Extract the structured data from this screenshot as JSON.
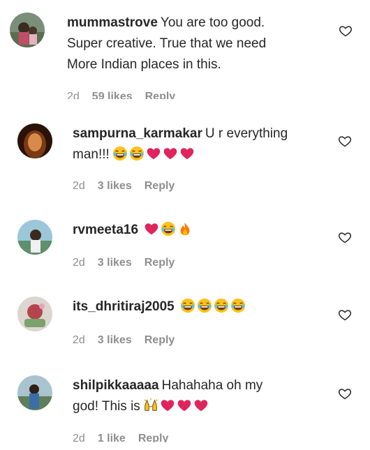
{
  "comments": [
    {
      "username": "mummastrove",
      "text_lines": [
        "You are too good.",
        "Super creative. True that we need",
        "More Indian places in this."
      ],
      "time": "2d",
      "likes": "59 likes",
      "reply": "Reply",
      "emojis": []
    },
    {
      "username": "sampurna_karmakar",
      "text_lines": [
        "U r everything",
        "man!!!"
      ],
      "time": "2d",
      "likes": "3 likes",
      "reply": "Reply",
      "emojis": [
        "laughing-emoji",
        "laughing-emoji",
        "red-heart-emoji",
        "red-heart-emoji",
        "red-heart-emoji"
      ]
    },
    {
      "username": "rvmeeta16",
      "text_lines": [
        ""
      ],
      "time": "2d",
      "likes": "3 likes",
      "reply": "Reply",
      "emojis": [
        "red-heart-emoji",
        "laughing-emoji",
        "fire-emoji"
      ]
    },
    {
      "username": "its_dhritiraj2005",
      "text_lines": [
        ""
      ],
      "time": "2d",
      "likes": "3 likes",
      "reply": "Reply",
      "emojis": [
        "laughing-emoji",
        "laughing-emoji",
        "laughing-emoji",
        "laughing-emoji"
      ]
    },
    {
      "username": "shilpikkaaaaa",
      "text_lines": [
        "Hahahaha oh my",
        "god! This is"
      ],
      "time": "2d",
      "likes": "1 like",
      "reply": "Reply",
      "emojis": [
        "raising-hands-emoji",
        "red-heart-emoji",
        "red-heart-emoji",
        "red-heart-emoji"
      ]
    }
  ],
  "colors": {
    "text": "#262626",
    "meta": "#8e8e8e",
    "heart": "#e0245e"
  },
  "icons": {
    "like_button": "heart-outline-icon"
  }
}
